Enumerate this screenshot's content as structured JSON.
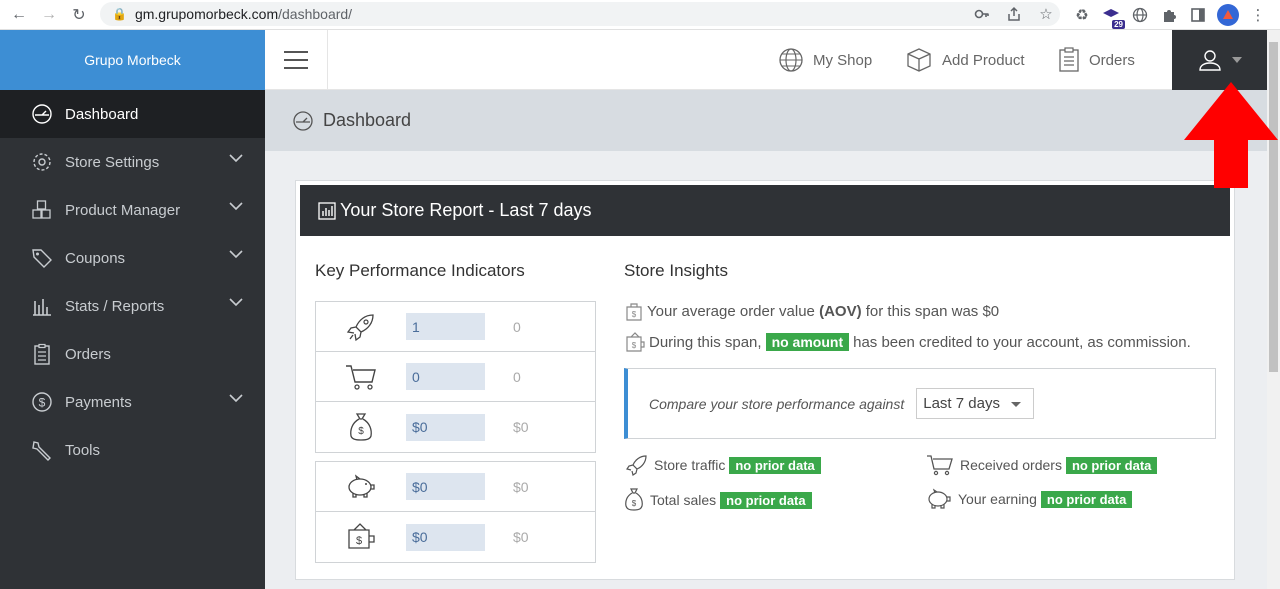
{
  "browser": {
    "url_domain": "gm.grupomorbeck.com",
    "url_path": "/dashboard/",
    "extension_badge": "29"
  },
  "sidebar": {
    "brand": "Grupo Morbeck",
    "items": [
      {
        "label": "Dashboard",
        "icon": "dashboard-icon",
        "active": true,
        "has_chevron": false
      },
      {
        "label": "Store Settings",
        "icon": "gear-icon",
        "active": false,
        "has_chevron": true
      },
      {
        "label": "Product Manager",
        "icon": "boxes-icon",
        "active": false,
        "has_chevron": true
      },
      {
        "label": "Coupons",
        "icon": "tag-icon",
        "active": false,
        "has_chevron": true
      },
      {
        "label": "Stats / Reports",
        "icon": "bar-chart-icon",
        "active": false,
        "has_chevron": true
      },
      {
        "label": "Orders",
        "icon": "clipboard-icon",
        "active": false,
        "has_chevron": false
      },
      {
        "label": "Payments",
        "icon": "dollar-circle-icon",
        "active": false,
        "has_chevron": true
      },
      {
        "label": "Tools",
        "icon": "wrench-icon",
        "active": false,
        "has_chevron": false
      }
    ]
  },
  "topbar": {
    "my_shop": "My Shop",
    "add_product": "Add Product",
    "orders": "Orders"
  },
  "page": {
    "title": "Dashboard"
  },
  "report": {
    "title": "Your Store Report - Last 7 days",
    "kpi_title": "Key Performance Indicators",
    "kpis": [
      {
        "icon": "rocket-icon",
        "value": "1",
        "prior": "0"
      },
      {
        "icon": "cart-icon",
        "value": "0",
        "prior": "0"
      },
      {
        "icon": "money-bag-icon",
        "value": "$0",
        "prior": "$0"
      },
      {
        "icon": "piggy-bank-icon",
        "value": "$0",
        "prior": "$0"
      },
      {
        "icon": "wallet-icon",
        "value": "$0",
        "prior": "$0"
      }
    ],
    "insights_title": "Store Insights",
    "aov_prefix": "Your average order value",
    "aov_bold": "(AOV)",
    "aov_suffix": "for this span was $0",
    "commission_prefix": "During this span,",
    "commission_badge": "no amount",
    "commission_suffix": "has been credited to your account, as commission.",
    "compare_label": "Compare your store performance against",
    "compare_value": "Last 7 days",
    "prior": [
      {
        "label": "Store traffic",
        "badge": "no prior data"
      },
      {
        "label": "Received orders",
        "badge": "no prior data"
      },
      {
        "label": "Total sales",
        "badge": "no prior data"
      },
      {
        "label": "Your earning",
        "badge": "no prior data"
      }
    ]
  },
  "colors": {
    "sidebar_bg": "#2f3236",
    "brand_bg": "#3d8ed4",
    "badge_green": "#3aa84a",
    "arrow_red": "#ff0000"
  }
}
